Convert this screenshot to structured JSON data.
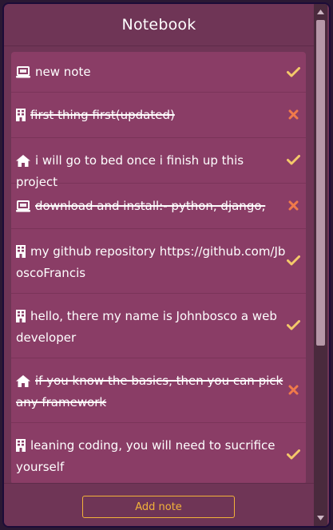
{
  "header": {
    "title": "Notebook"
  },
  "notes": [
    {
      "text": "new note",
      "icon": "laptop-icon",
      "status": "complete",
      "done": false
    },
    {
      "text": "first thing first(updated)",
      "icon": "building-icon",
      "status": "incomplete",
      "done": true
    },
    {
      "text": "i will go to bed once i finish up this project",
      "icon": "home-icon",
      "status": "complete",
      "done": false
    },
    {
      "text": "download and install:- python, django,",
      "icon": "laptop-icon",
      "status": "incomplete",
      "done": true
    },
    {
      "text": "my github repository https://github.com/JboscoFrancis",
      "icon": "building-icon",
      "status": "complete",
      "done": false
    },
    {
      "text": "hello, there my name is Johnbosco a web developer",
      "icon": "building-icon",
      "status": "complete",
      "done": false
    },
    {
      "text": "if you know the basics, then you can pick any framework",
      "icon": "home-icon",
      "status": "incomplete",
      "done": true
    },
    {
      "text": "leaning coding, you will need to sucrifice yourself",
      "icon": "building-icon",
      "status": "complete",
      "done": false
    }
  ],
  "footer": {
    "add_label": "Add note"
  },
  "colors": {
    "accent": "#f2b23a",
    "check": "#f4c96a",
    "cross": "#f07a4a",
    "panel": "#8a3d66"
  }
}
